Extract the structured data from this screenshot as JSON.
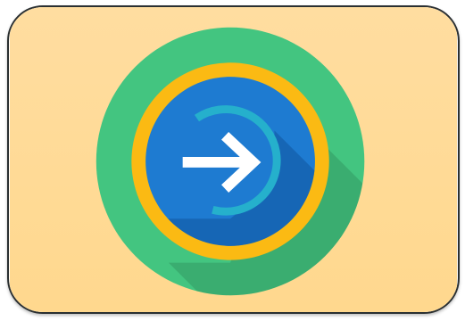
{
  "icon": {
    "name": "forward-arrow-icon",
    "meaning": "next / forward"
  },
  "colors": {
    "tile_background": "#FFDDA0",
    "outer_ring": "#43C580",
    "mid_ring": "#FBBA13",
    "inner_disc": "#1E7BD1",
    "progress_arc": "#25B0CC",
    "long_shadow": "#00000033",
    "arrow": "#FFFFFF",
    "tile_border": "#2A2F31"
  }
}
